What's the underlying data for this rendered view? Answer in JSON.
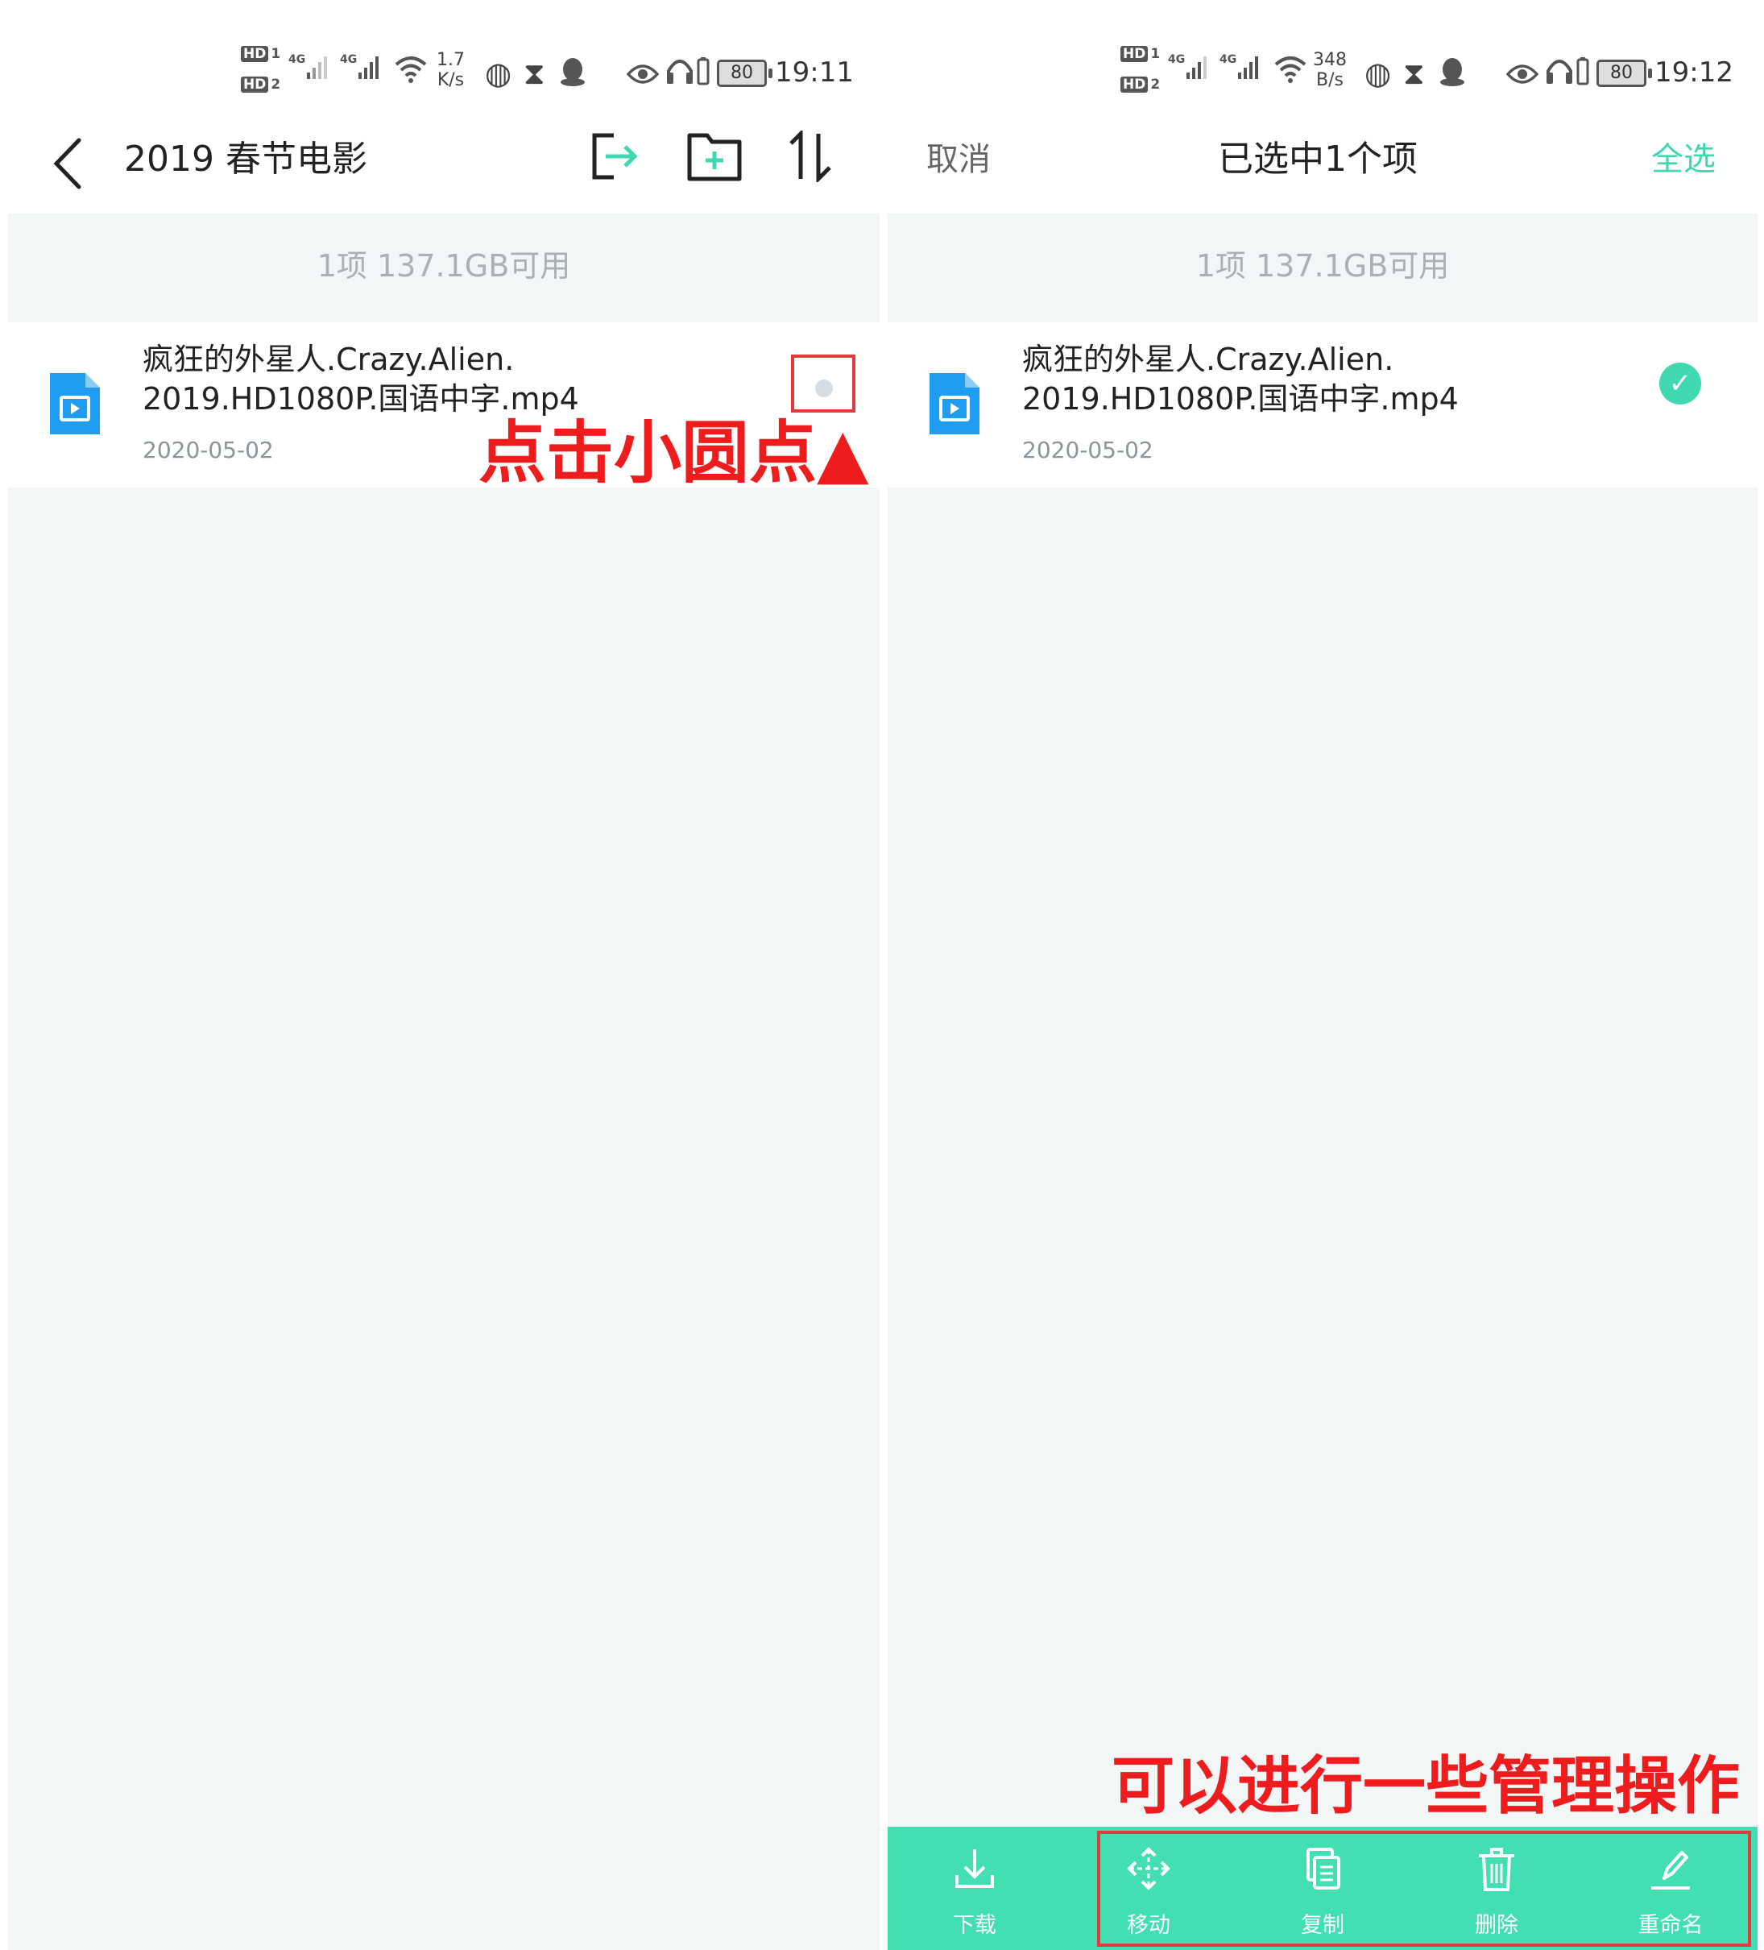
{
  "colors": {
    "accent": "#42dfb5",
    "annotation_red": "#ee1c1c",
    "file_icon_blue": "#1e9df2"
  },
  "left": {
    "status": {
      "hd1": "HD",
      "hd1_sub": "1",
      "hd2": "HD",
      "hd2_sub": "2",
      "sig1": "4G",
      "sig2": "4G",
      "speed_value": "1.7",
      "speed_unit": "K/s",
      "battery": "80",
      "time": "19:11"
    },
    "toolbar": {
      "title": "2019 春节电影",
      "icons": [
        "exit-icon",
        "new-folder-icon",
        "sort-icon"
      ]
    },
    "summary": "1项 137.1GB可用",
    "file": {
      "name_line1": "疯狂的外星人.Crazy.Alien.",
      "name_line2": "2019.HD1080P.国语中字.mp4",
      "date": "2020-05-02"
    },
    "annotation": "点击小圆点▲"
  },
  "right": {
    "status": {
      "hd1": "HD",
      "hd1_sub": "1",
      "hd2": "HD",
      "hd2_sub": "2",
      "sig1": "4G",
      "sig2": "4G",
      "speed_value": "348",
      "speed_unit": "B/s",
      "battery": "80",
      "time": "19:12"
    },
    "toolbar": {
      "cancel": "取消",
      "title": "已选中1个项",
      "select_all": "全选"
    },
    "summary": "1项 137.1GB可用",
    "file": {
      "name_line1": "疯狂的外星人.Crazy.Alien.",
      "name_line2": "2019.HD1080P.国语中字.mp4",
      "date": "2020-05-02"
    },
    "annotation": "可以进行一些管理操作",
    "actions": [
      {
        "label": "下载",
        "icon": "download-icon"
      },
      {
        "label": "移动",
        "icon": "move-icon"
      },
      {
        "label": "复制",
        "icon": "copy-icon"
      },
      {
        "label": "删除",
        "icon": "delete-icon"
      },
      {
        "label": "重命名",
        "icon": "rename-icon"
      }
    ]
  }
}
